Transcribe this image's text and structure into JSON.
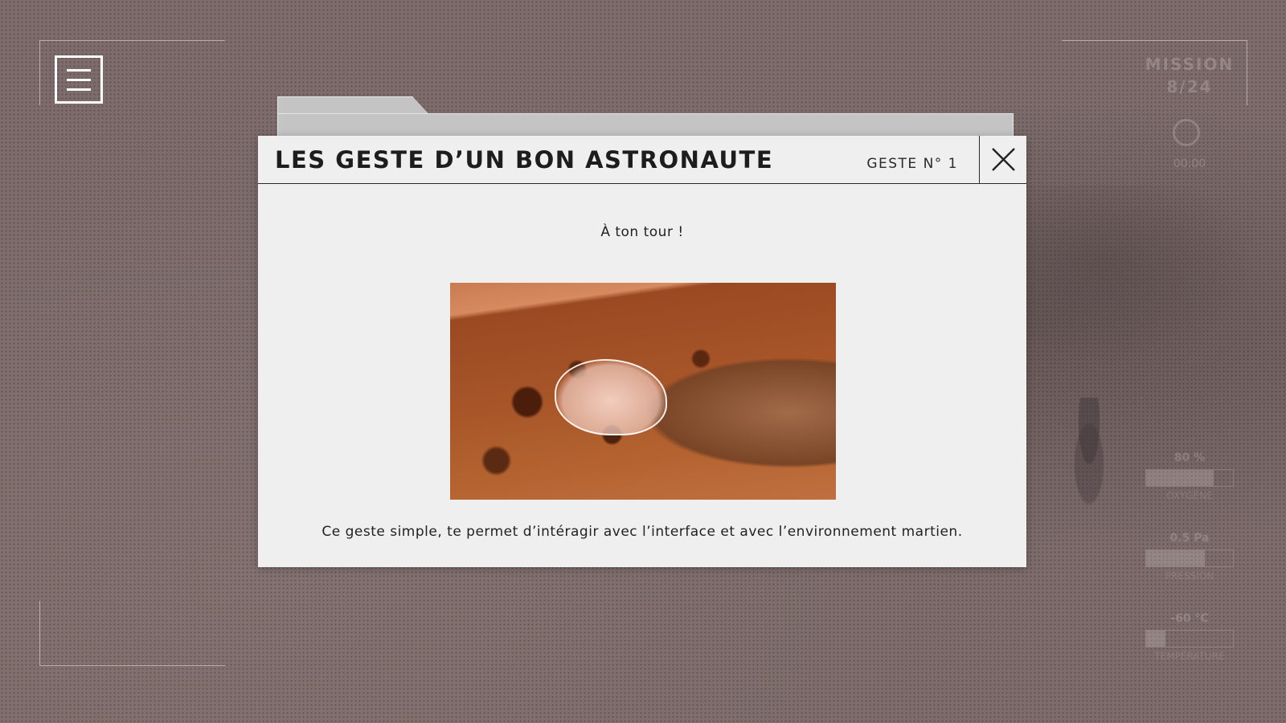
{
  "menu": {
    "icon": "hamburger-icon"
  },
  "hud": {
    "mission_label": "MISSION 8/24",
    "timer_icon": "clock-icon",
    "timer_value": "00:00",
    "meters": [
      {
        "value": "80 %",
        "fill": 0.78,
        "label": "OXYGÈNE"
      },
      {
        "value": "0.5 Pa",
        "fill": 0.68,
        "label": "PRESSION"
      },
      {
        "value": "-60 °C",
        "fill": 0.22,
        "label": "TEMPÉRATURE"
      }
    ]
  },
  "modal": {
    "title": "LES GESTE D’UN BON ASTRONAUTE",
    "gesture_number": "GESTE N° 1",
    "close_icon": "close-icon",
    "prompt": "À ton tour !",
    "description": "Ce geste simple, te permet d’intéragir avec l’interface et avec l’environnement martien."
  },
  "colors": {
    "modal_bg": "#efefef",
    "title": "#1d1d1d",
    "background": "#7d6c6b"
  }
}
